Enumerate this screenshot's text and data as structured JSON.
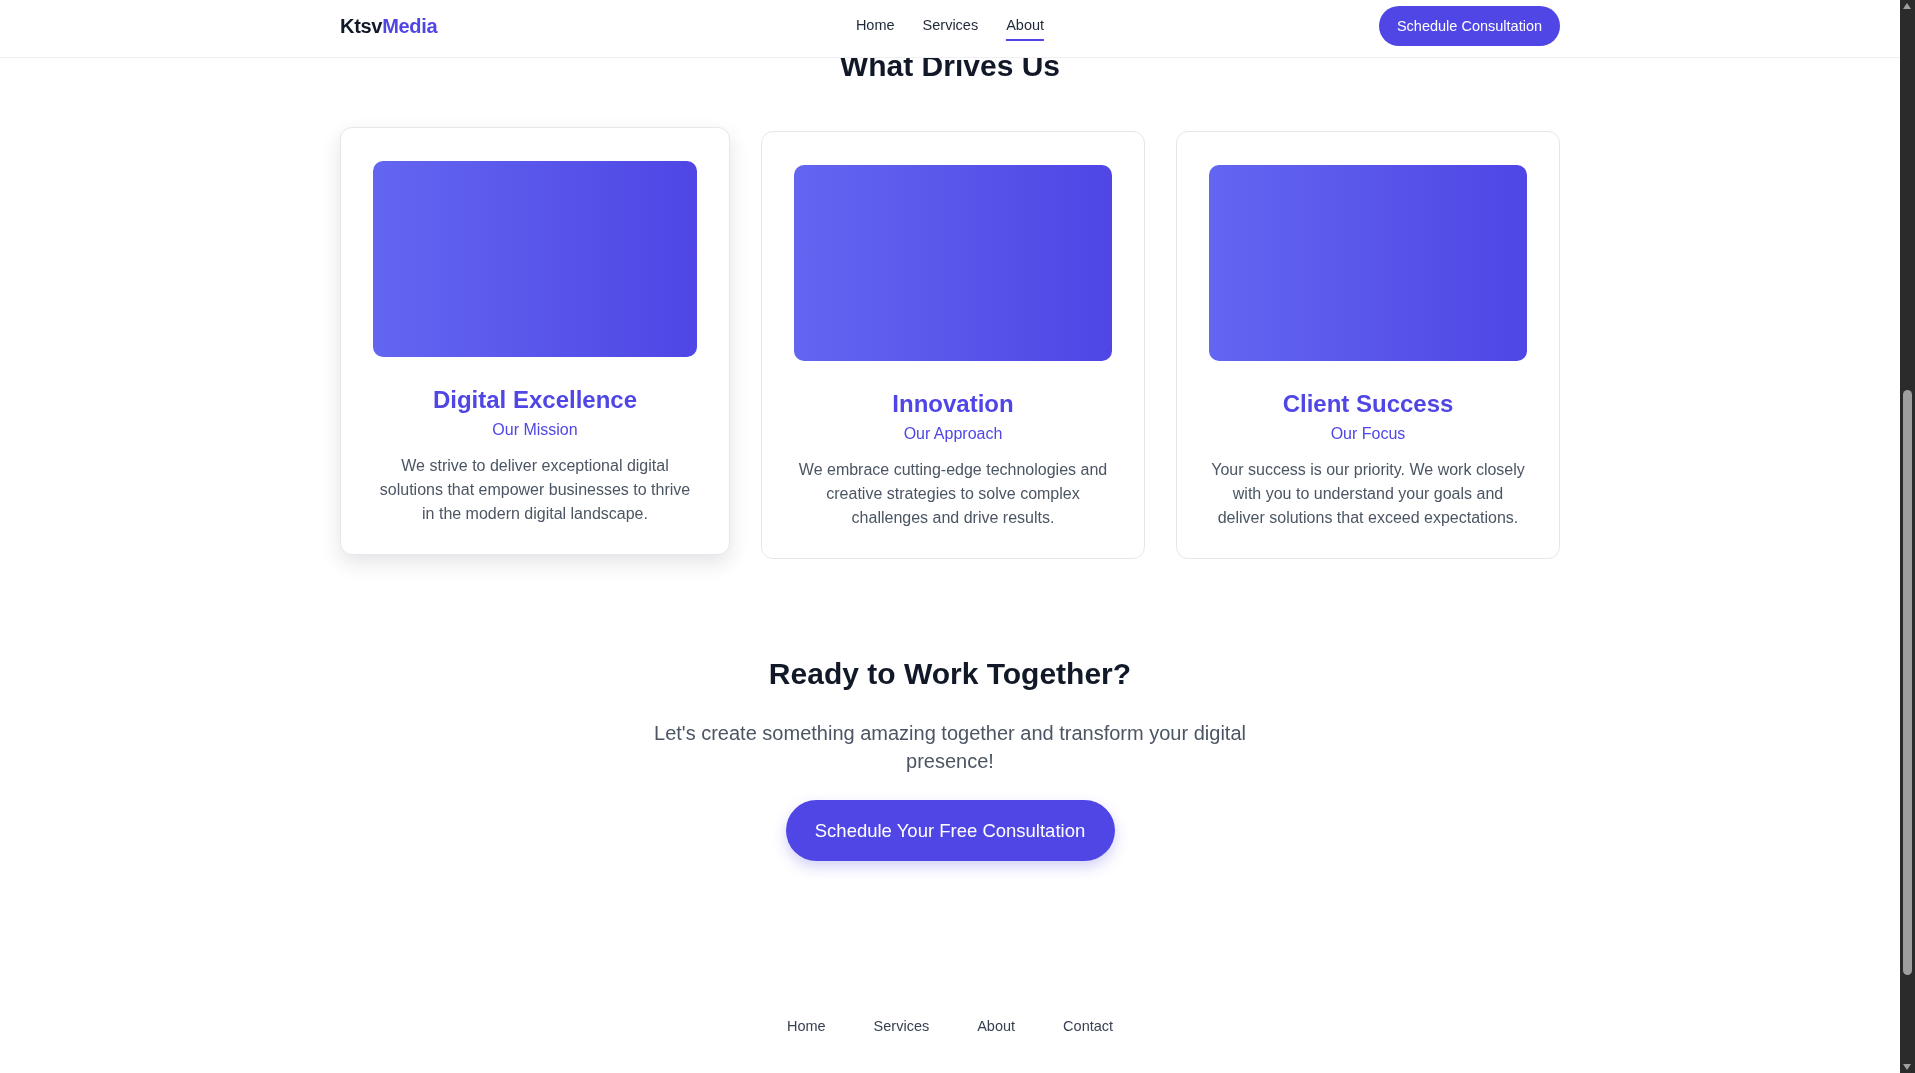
{
  "header": {
    "logo": {
      "part_1": "Ktsv",
      "part_2": "Media"
    },
    "nav": [
      {
        "label": "Home",
        "selected": false
      },
      {
        "label": "Services",
        "selected": false
      },
      {
        "label": "About",
        "selected": true
      }
    ],
    "button": "Schedule Consultation"
  },
  "section_title": "What Drives Us",
  "cards": [
    {
      "title": "Digital Excellence",
      "subtitle": "Our Mission",
      "text": "We strive to deliver exceptional digital solutions that empower businesses to thrive in the modern digital landscape.",
      "raised": true
    },
    {
      "title": "Innovation",
      "subtitle": "Our Approach",
      "text": "We embrace cutting-edge technologies and creative strategies to solve complex challenges and drive results.",
      "raised": false
    },
    {
      "title": "Client Success",
      "subtitle": "Our Focus",
      "text": "Your success is our priority. We work closely with you to understand your goals and deliver solutions that exceed expectations.",
      "raised": false
    }
  ],
  "cta": {
    "title": "Ready to Work Together?",
    "text": "Let's create something amazing together and transform your digital presence!",
    "button": "Schedule Your Free Consultation"
  },
  "footer": {
    "links": [
      "Home",
      "Services",
      "About",
      "Contact"
    ]
  }
}
